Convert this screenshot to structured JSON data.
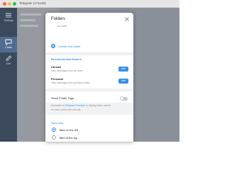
{
  "window": {
    "title": "Telegram (171148)"
  },
  "sidebar": {
    "items": [
      {
        "label": "Settings",
        "icon": "settings-icon"
      },
      {
        "label": "Chats",
        "icon": "chats-icon"
      },
      {
        "label": "Edit",
        "icon": "edit-icon"
      }
    ]
  },
  "dialog": {
    "title": "Folders",
    "existing_folder_sub": "No chats",
    "create_label": "Create new folder",
    "recommended_heading": "Recommended folders",
    "recommended": [
      {
        "name": "Unread",
        "desc": "New messages from all chats.",
        "button": "Add"
      },
      {
        "name": "Personal",
        "desc": "Only messages from personal chats.",
        "button": "Add"
      }
    ],
    "show_tags_label": "Show Folder Tags",
    "show_tags_enabled": false,
    "subscribe_prefix": "Subscribe to",
    "subscribe_link": "Telegram Premium",
    "subscribe_suffix": "to display folder names",
    "subscribe_line2": "for each chat in the chat list.",
    "tabs_heading": "Tabs view",
    "tabs_options": [
      {
        "label": "Tabs on the left",
        "selected": true
      },
      {
        "label": "Tabs at the top",
        "selected": false
      }
    ]
  },
  "colors": {
    "accent": "#3390ec",
    "sidebar": "#3a4a5c",
    "sidebar_active": "#4f6d8e"
  }
}
